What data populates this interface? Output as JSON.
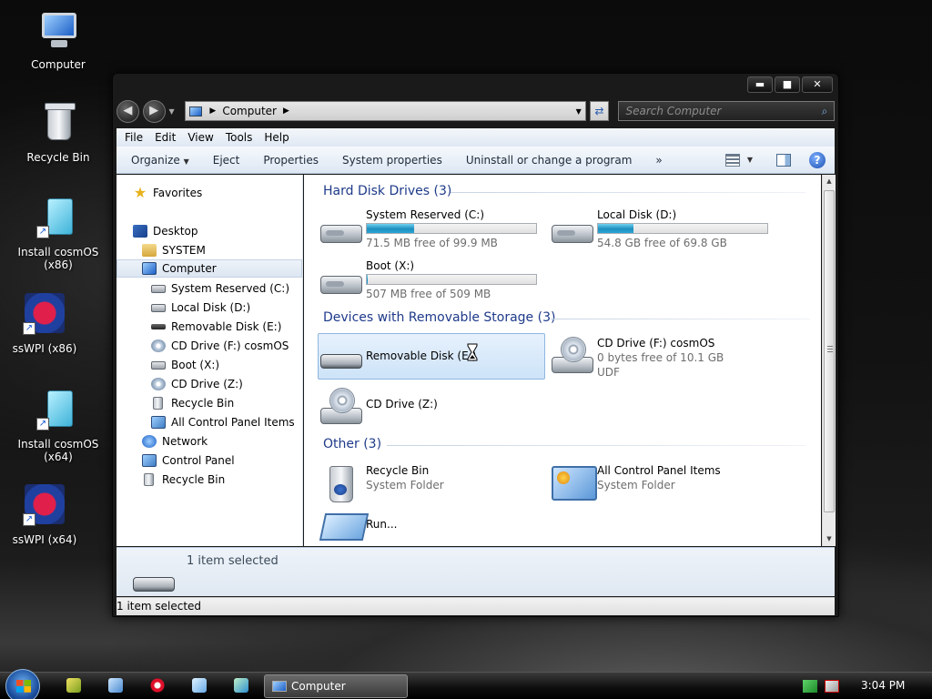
{
  "desktop": {
    "icons": [
      {
        "label": "Computer"
      },
      {
        "label": "Recycle Bin"
      },
      {
        "label": "Install cosmOS (x86)"
      },
      {
        "label": "ssWPI (x86)"
      },
      {
        "label": "Install cosmOS (x64)"
      },
      {
        "label": "ssWPI (x64)"
      }
    ]
  },
  "window": {
    "controls": {
      "minimize": "▬",
      "maximize": "■",
      "close": "✕"
    },
    "address": {
      "location": "Computer"
    },
    "search": {
      "placeholder": "Search Computer"
    },
    "menu": [
      "File",
      "Edit",
      "View",
      "Tools",
      "Help"
    ],
    "toolbar": {
      "organize": "Organize",
      "eject": "Eject",
      "properties": "Properties",
      "system_properties": "System properties",
      "uninstall": "Uninstall or change a program",
      "more": "»"
    },
    "nav": {
      "favorites": "Favorites",
      "desktop": "Desktop",
      "system": "SYSTEM",
      "computer": "Computer",
      "system_reserved": "System Reserved (C:)",
      "local_disk": "Local Disk (D:)",
      "removable": "Removable Disk (E:)",
      "cd_f": "CD Drive (F:) cosmOS",
      "boot": "Boot (X:)",
      "cd_z": "CD Drive (Z:)",
      "recycle_bin_sub": "Recycle Bin",
      "all_cpl": "All Control Panel Items",
      "network": "Network",
      "control_panel": "Control Panel",
      "recycle_bin": "Recycle Bin"
    },
    "groups": {
      "hdd": "Hard Disk Drives (3)",
      "removable": "Devices with Removable Storage (3)",
      "other": "Other (3)"
    },
    "drives": {
      "c": {
        "name": "System Reserved (C:)",
        "free": "71.5 MB free of 99.9 MB",
        "used_fraction": 0.28
      },
      "d": {
        "name": "Local Disk (D:)",
        "free": "54.8 GB free of 69.8 GB",
        "used_fraction": 0.21
      },
      "x": {
        "name": "Boot (X:)",
        "free": "507 MB free of 509 MB",
        "used_fraction": 0.004
      },
      "e": {
        "name": "Removable Disk (E:)"
      },
      "f": {
        "name": "CD Drive (F:) cosmOS",
        "free": "0 bytes free of 10.1 GB",
        "fs": "UDF"
      },
      "z": {
        "name": "CD Drive (Z:)"
      }
    },
    "other": {
      "recycle": {
        "name": "Recycle Bin",
        "type": "System Folder"
      },
      "cpl": {
        "name": "All Control Panel Items",
        "type": "System Folder"
      },
      "run": {
        "name": "Run..."
      }
    },
    "details": {
      "text": "1 item selected"
    },
    "status": {
      "text": "1 item selected"
    }
  },
  "taskbar": {
    "task": "Computer",
    "clock": "3:04 PM"
  }
}
